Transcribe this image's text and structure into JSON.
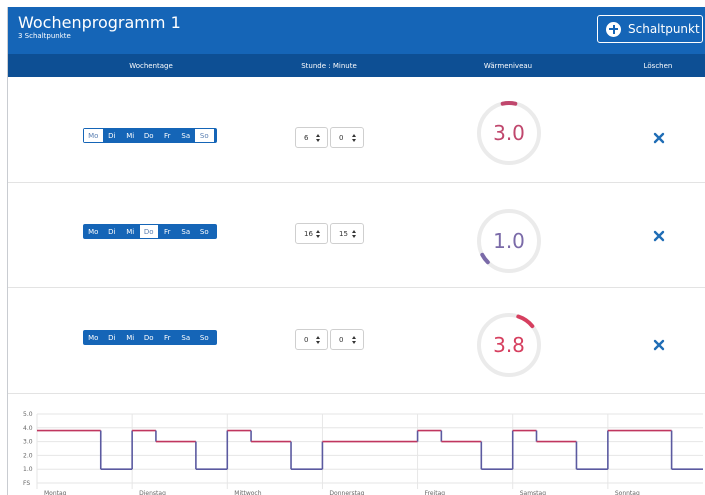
{
  "header": {
    "title": "Wochenprogramm 1",
    "subtitle": "3 Schaltpunkte",
    "add_button_label": "Schaltpunkt"
  },
  "table": {
    "columns": [
      "Wochentage",
      "Stunde : Minute",
      "Wärmeniveau",
      "Löschen"
    ]
  },
  "rows": [
    {
      "days": [
        {
          "label": "Mo",
          "active": false
        },
        {
          "label": "Di",
          "active": true
        },
        {
          "label": "Mi",
          "active": true
        },
        {
          "label": "Do",
          "active": true
        },
        {
          "label": "Fr",
          "active": true
        },
        {
          "label": "Sa",
          "active": true
        },
        {
          "label": "So",
          "active": false
        }
      ],
      "hour": "6",
      "minute": "0",
      "level": "3.0",
      "level_color": "#c0476d"
    },
    {
      "days": [
        {
          "label": "Mo",
          "active": true
        },
        {
          "label": "Di",
          "active": true
        },
        {
          "label": "Mi",
          "active": true
        },
        {
          "label": "Do",
          "active": false
        },
        {
          "label": "Fr",
          "active": true
        },
        {
          "label": "Sa",
          "active": true
        },
        {
          "label": "So",
          "active": true
        }
      ],
      "hour": "16",
      "minute": "15",
      "level": "1.0",
      "level_color": "#7a6aa8"
    },
    {
      "days": [
        {
          "label": "Mo",
          "active": true
        },
        {
          "label": "Di",
          "active": true
        },
        {
          "label": "Mi",
          "active": true
        },
        {
          "label": "Do",
          "active": true
        },
        {
          "label": "Fr",
          "active": true
        },
        {
          "label": "Sa",
          "active": true
        },
        {
          "label": "So",
          "active": true
        }
      ],
      "hour": "0",
      "minute": "0",
      "level": "3.8",
      "level_color": "#d63f5f"
    }
  ],
  "colors": {
    "header": "#1565b7",
    "table_header": "#0d4f94",
    "high": "#c0365f",
    "low": "#5b5aa0"
  },
  "chart_data": {
    "type": "line",
    "step": true,
    "y_ticks": [
      "5.0",
      "4.0",
      "3.0",
      "2.0",
      "1.0",
      "FS"
    ],
    "ylim": [
      0,
      5
    ],
    "x_labels": [
      "Montag",
      "Dienstag",
      "Mittwoch",
      "Donnerstag",
      "Freitag",
      "Samstag",
      "Sonntag"
    ],
    "x_unit": "day (0 = Montag 00:00)",
    "series": [
      {
        "points": [
          [
            0.0,
            3.8
          ],
          [
            0.67,
            1.0
          ],
          [
            1.0,
            3.8
          ],
          [
            1.25,
            3.0
          ],
          [
            1.67,
            1.0
          ],
          [
            2.0,
            3.8
          ],
          [
            2.25,
            3.0
          ],
          [
            2.67,
            1.0
          ],
          [
            3.0,
            3.0
          ],
          [
            4.0,
            3.8
          ],
          [
            4.25,
            3.0
          ],
          [
            4.67,
            1.0
          ],
          [
            5.0,
            3.8
          ],
          [
            5.25,
            3.0
          ],
          [
            5.67,
            1.0
          ],
          [
            6.0,
            3.8
          ],
          [
            6.67,
            1.0
          ],
          [
            7.0,
            1.0
          ]
        ]
      }
    ],
    "grid": true
  }
}
